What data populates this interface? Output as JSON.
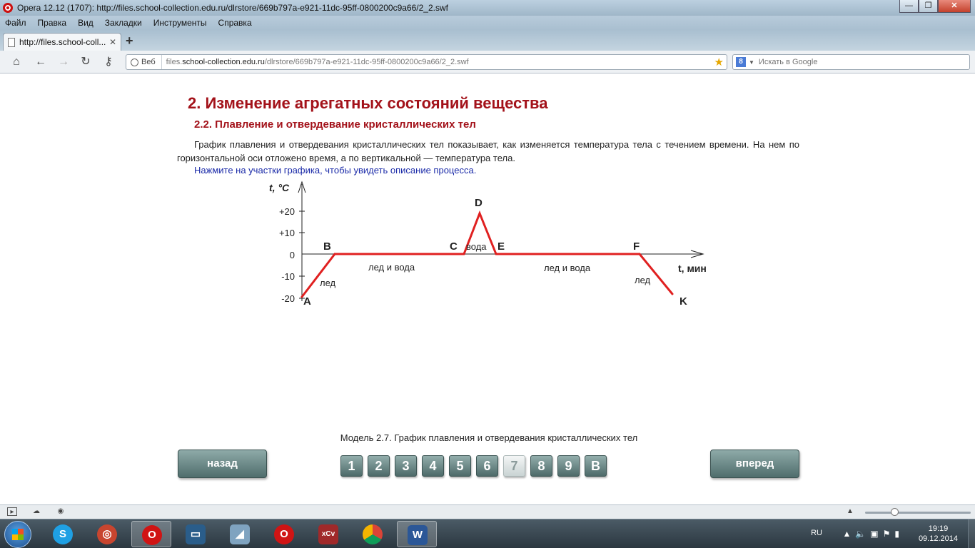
{
  "window": {
    "title": "Opera 12.12 (1707): http://files.school-collection.edu.ru/dlrstore/669b797a-e921-11dc-95ff-0800200c9a66/2_2.swf",
    "minimize": "—",
    "maximize": "❐",
    "close": "✕"
  },
  "menu": {
    "items": [
      "Файл",
      "Правка",
      "Вид",
      "Закладки",
      "Инструменты",
      "Справка"
    ]
  },
  "tabs": {
    "active_label": "http://files.school-coll...",
    "close": "✕",
    "new_tab": "+"
  },
  "addressbar": {
    "badge": "Веб",
    "url_prefix": "files.",
    "url_domain": "school-collection.edu.ru",
    "url_path": "/dlrstore/669b797a-e921-11dc-95ff-0800200c9a66/2_2.swf",
    "search_placeholder": "Искать в Google"
  },
  "page": {
    "heading": "2. Изменение агрегатных состояний вещества",
    "subheading": "2.2. Плавление и отвердевание кристаллических тел",
    "paragraph": "График плавления и отвердевания кристаллических тел показывает, как изменяется температура тела с течением времени. На нем по горизонтальной оси отложено время, а по вертикальной — температура тела.",
    "hint": "Нажмите на участки графика, чтобы увидеть описание процесса.",
    "caption": "Модель 2.7. График плавления и отвердевания кристаллических тел",
    "back_label": "назад",
    "forward_label": "вперед",
    "pages": [
      "1",
      "2",
      "3",
      "4",
      "5",
      "6",
      "7",
      "8",
      "9",
      "В"
    ],
    "active_page": "7"
  },
  "graph": {
    "y_axis_label": "t, °C",
    "x_axis_label": "t, мин",
    "y_ticks": [
      "+20",
      "+10",
      "0",
      "-10",
      "-20"
    ],
    "point_labels": [
      "A",
      "B",
      "C",
      "D",
      "E",
      "F",
      "K"
    ],
    "segment_labels": [
      "лед",
      "лед и вода",
      "вода",
      "лед и вода",
      "лед"
    ],
    "line_color": "#e02020"
  },
  "taskbar": {
    "lang": "RU",
    "time": "19:19",
    "date": "09.12.2014"
  }
}
